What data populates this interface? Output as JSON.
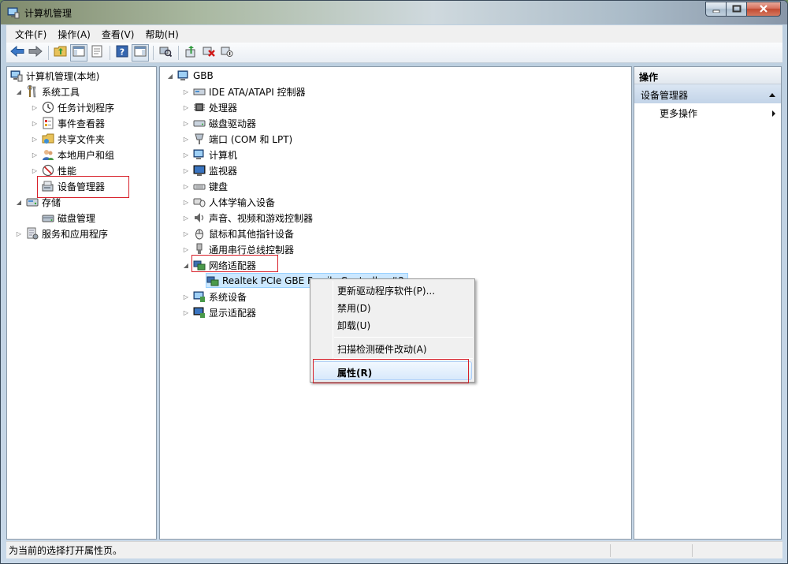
{
  "window": {
    "title": "计算机管理"
  },
  "menu": [
    "文件(F)",
    "操作(A)",
    "查看(V)",
    "帮助(H)"
  ],
  "left_tree": {
    "root": "计算机管理(本地)",
    "system_tools": "系统工具",
    "task_scheduler": "任务计划程序",
    "event_viewer": "事件查看器",
    "shared_folders": "共享文件夹",
    "local_users": "本地用户和组",
    "performance": "性能",
    "device_manager": "设备管理器",
    "storage": "存储",
    "disk_management": "磁盘管理",
    "services_apps": "服务和应用程序"
  },
  "device_tree": {
    "root": "GBB",
    "categories": [
      "IDE ATA/ATAPI 控制器",
      "处理器",
      "磁盘驱动器",
      "端口 (COM 和 LPT)",
      "计算机",
      "监视器",
      "键盘",
      "人体学输入设备",
      "声音、视频和游戏控制器",
      "鼠标和其他指针设备",
      "通用串行总线控制器",
      "网络适配器"
    ],
    "network_child": "Realtek PCIe GBE Family Controller #2",
    "after": [
      "系统设备",
      "显示适配器"
    ]
  },
  "actions": {
    "header": "操作",
    "section": "设备管理器",
    "more": "更多操作"
  },
  "context_menu": {
    "update_driver": "更新驱动程序软件(P)...",
    "disable": "禁用(D)",
    "uninstall": "卸载(U)",
    "scan": "扫描检测硬件改动(A)",
    "properties": "属性(R)"
  },
  "status": {
    "text": "为当前的选择打开属性页。"
  },
  "colors": {
    "highlight_box": "#d8202a",
    "selection": "#cce8ff"
  }
}
